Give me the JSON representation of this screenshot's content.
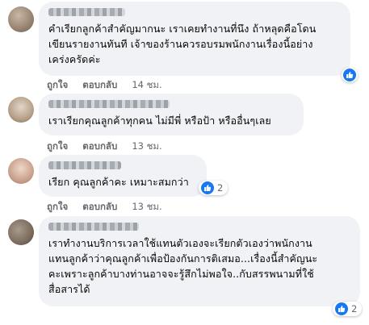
{
  "comments": [
    {
      "text": "คำเรียกลูกค้าสำคัญมากนะ เราเคยทำงานที่นึง ถ้าหลุดคือโดน\nเขียนรายงานทันที เจ้าของร้านควรอบรมพนักงานเรื่องนี้อย่าง\nเคร่งครัดค่ะ",
      "like_label": "ถูกใจ",
      "reply_label": "ตอบกลับ",
      "time": "14 ชม.",
      "reaction_count": ""
    },
    {
      "text": "เราเรียกคุณลูกค้าทุกคน ไม่มีพี่ หรือป้า หรืออื่นๆเลย",
      "like_label": "ถูกใจ",
      "reply_label": "ตอบกลับ",
      "time": "13 ชม.",
      "reaction_count": ""
    },
    {
      "text": "เรียก คุณลูกค้าคะ เหมาะสมกว่า",
      "like_label": "ถูกใจ",
      "reply_label": "ตอบกลับ",
      "time": "13 ชม.",
      "reaction_count": "2"
    },
    {
      "text": "เราทำงานบริการเวลาใช้แทนตัวเองจะเรียกตัวเองว่าพนักงาน\nแทนลูกค้าว่าคุณลูกค้าเพื่อป้องกันการติเสมอ...เรื่องนี้สำคัญนะ\nคะเพราะลูกค้าบางท่านอาจจะรู้สึกไม่พอใจ..กับสรรพนามที่ใช้\nสื่อสารได้",
      "like_label": "",
      "reply_label": "",
      "time": "",
      "reaction_count": "2"
    }
  ],
  "colors": {
    "bubble": "#f0f2f5",
    "like_blue": "#1877f2",
    "meta_text": "#65676b"
  },
  "icons": {
    "reaction": "like-thumb-icon"
  }
}
